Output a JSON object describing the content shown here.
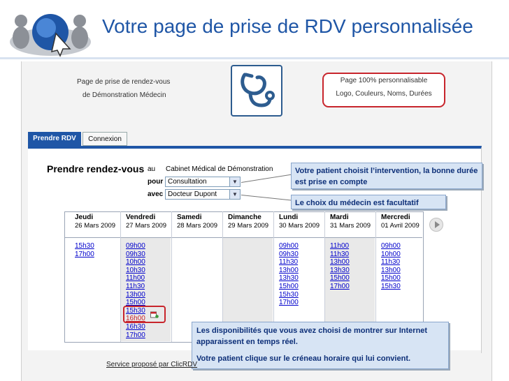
{
  "slide": {
    "title": "Votre page de prise de RDV personnalisée"
  },
  "header": {
    "left_line1": "Page de prise de rendez-vous",
    "left_line2": "de Démonstration Médecin",
    "callout_line1": "Page 100% personnalisable",
    "callout_line2": "Logo, Couleurs, Noms, Durées",
    "logo_icon": "stethoscope-icon"
  },
  "tabs": [
    {
      "label": "Prendre RDV",
      "active": true
    },
    {
      "label": "Connexion",
      "active": false
    }
  ],
  "form": {
    "title": "Prendre rendez-vous",
    "au_label": "au",
    "cabinet": "Cabinet Médical de Démonstration",
    "pour_label": "pour",
    "pour_value": "Consultation",
    "avec_label": "avec",
    "avec_value": "Docteur Dupont"
  },
  "callouts": {
    "intervention": "Votre patient choisit l’intervention, la bonne durée est prise en compte",
    "medecin": "Le choix du médecin est facultatif",
    "dispo_line1": "Les disponibilités que vous avez choisi de montrer sur Internet apparaissent en temps réel.",
    "dispo_line2": "Votre patient clique sur le créneau horaire qui lui convient."
  },
  "calendar": {
    "days": [
      {
        "day": "Jeudi",
        "date": "26 Mars 2009",
        "slots": [
          "15h30",
          "17h00"
        ]
      },
      {
        "day": "Vendredi",
        "date": "27 Mars 2009",
        "slots": [
          "09h00",
          "09h30",
          "10h00",
          "10h30",
          "11h00",
          "11h30",
          "13h00",
          "15h00",
          "15h30",
          "16h00",
          "16h30",
          "17h00"
        ]
      },
      {
        "day": "Samedi",
        "date": "28 Mars 2009",
        "slots": []
      },
      {
        "day": "Dimanche",
        "date": "29 Mars 2009",
        "slots": []
      },
      {
        "day": "Lundi",
        "date": "30 Mars 2009",
        "slots": [
          "09h00",
          "09h30",
          "11h30",
          "13h00",
          "13h30",
          "15h00",
          "15h30",
          "17h00"
        ]
      },
      {
        "day": "Mardi",
        "date": "31 Mars 2009",
        "slots": [
          "11h00",
          "11h30",
          "13h00",
          "13h30",
          "15h00",
          "17h00"
        ]
      },
      {
        "day": "Mercredi",
        "date": "01 Avril 2009",
        "slots": [
          "09h00",
          "10h00",
          "11h30",
          "13h00",
          "15h00",
          "15h30"
        ]
      }
    ],
    "highlighted_slot": "16h00",
    "next_icon": "play-icon"
  },
  "footer": {
    "service": "Service proposé par ClicRDV"
  },
  "colors": {
    "title": "#1f56a6",
    "accent_red": "#c8252c",
    "tab_active": "#1f56a6",
    "callout_bg": "#d7e4f4"
  }
}
